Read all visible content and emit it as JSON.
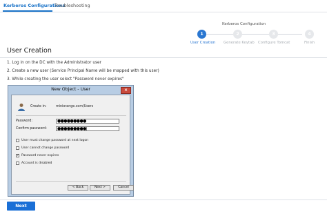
{
  "tabs": [
    {
      "label": "Kerberos Configurations",
      "active": true
    },
    {
      "label": "Troubleshooting",
      "active": false
    }
  ],
  "stepper": {
    "title": "Kerberos Configuration",
    "steps": [
      {
        "number": "1",
        "label": "User Creation",
        "active": true
      },
      {
        "number": "2",
        "label": "Generate Keytab",
        "active": false
      },
      {
        "number": "3",
        "label": "Configure Tomcat",
        "active": false
      },
      {
        "number": "4",
        "label": "Finish",
        "active": false
      }
    ]
  },
  "section_title": "User Creation",
  "instructions": [
    "1. Log in on the DC with the Administrator user",
    "2. Create a new user (Service Principal Name will be mapped with this user)",
    "3. While creating the user select \"Password never expires\""
  ],
  "dialog": {
    "title": "New Object - User",
    "close_glyph": "×",
    "create_in_label": "Create in:",
    "create_in_value": "miniorange.com/Users",
    "password_label": "Password:",
    "password_value": "●●●●●●●●●",
    "confirm_label": "Confirm password:",
    "confirm_value": "●●●●●●●●●|",
    "checkboxes": [
      {
        "label": "User must change password at next logon",
        "checked": false
      },
      {
        "label": "User cannot change password",
        "checked": false
      },
      {
        "label": "Password never expires",
        "checked": true
      },
      {
        "label": "Account is disabled",
        "checked": false
      }
    ],
    "check_glyph": "✓",
    "buttons": {
      "back": "< Back",
      "next": "Next >",
      "cancel": "Cancel"
    }
  },
  "next_button": "Next",
  "colors": {
    "accent": "#1a6fd6",
    "step_active": "#2a77d1",
    "step_pending": "#e6e8eb",
    "dialog_frame": "#b8cde4",
    "close_red": "#c94a3d"
  },
  "icons": {
    "user": "user-icon",
    "close": "close-icon",
    "check": "check-icon"
  }
}
